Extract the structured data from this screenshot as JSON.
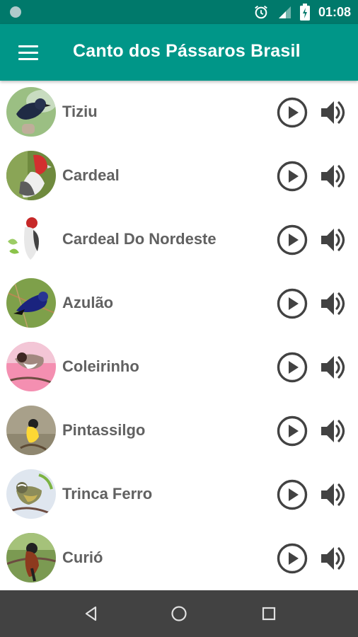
{
  "status_bar": {
    "time": "01:08",
    "icons": [
      "notification-dot-icon",
      "alarm-clock-icon",
      "signal-icon",
      "battery-icon"
    ]
  },
  "app_bar": {
    "title": "Canto dos Pássaros Brasil",
    "menu_icon": "hamburger-menu-icon"
  },
  "birds": [
    {
      "name": "Tiziu"
    },
    {
      "name": "Cardeal"
    },
    {
      "name": "Cardeal Do Nordeste"
    },
    {
      "name": "Azulão"
    },
    {
      "name": "Coleirinho"
    },
    {
      "name": "Pintassilgo"
    },
    {
      "name": "Trinca Ferro"
    },
    {
      "name": "Curió"
    }
  ],
  "row_icons": {
    "play": "play-circle-icon",
    "volume": "volume-icon"
  },
  "nav_bar": {
    "icons": [
      "back-icon",
      "home-icon",
      "recents-icon"
    ]
  },
  "colors": {
    "primary": "#009688",
    "primary_dark": "#00796b",
    "text": "#616161",
    "icon": "#424242",
    "nav_bar": "#424242"
  }
}
